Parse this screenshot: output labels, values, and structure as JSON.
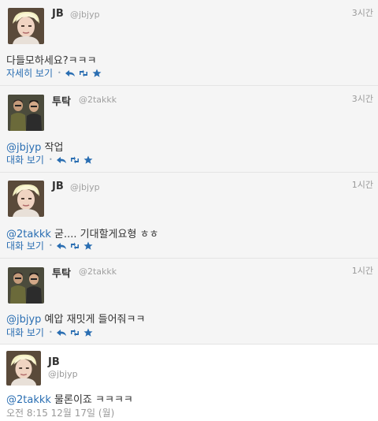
{
  "tweets": [
    {
      "name": "JB",
      "handle": "@jbjyp",
      "time": "3시간",
      "mention": "",
      "text": "다들모하세요?ㅋㅋㅋ",
      "action_label": "자세히 보기",
      "avatar": "blonde-person-avatar"
    },
    {
      "name": "투탁",
      "handle": "@2takkk",
      "time": "3시간",
      "mention": "@jbjyp",
      "text": " 작업",
      "action_label": "대화 보기",
      "avatar": "two-men-avatar"
    },
    {
      "name": "JB",
      "handle": "@jbjyp",
      "time": "1시간",
      "mention": "@2takkk",
      "text": " 굳.... 기대할게요형 ㅎㅎ",
      "action_label": "대화 보기",
      "avatar": "blonde-person-avatar"
    },
    {
      "name": "투탁",
      "handle": "@2takkk",
      "time": "1시간",
      "mention": "@jbjyp",
      "text": " 예압 재밋게 들어줘ㅋㅋ",
      "action_label": "대화 보기",
      "avatar": "two-men-avatar"
    }
  ],
  "expanded": {
    "name": "JB",
    "handle": "@jbjyp",
    "mention": "@2takkk",
    "text": " 물론이죠 ㅋㅋㅋㅋ",
    "timestamp": "오전 8:15 12월 17일 (월)",
    "avatar": "blonde-person-avatar"
  },
  "icons": {
    "reply": "reply-icon",
    "retweet": "retweet-icon",
    "favorite": "star-icon"
  },
  "colors": {
    "link": "#2a6eb2",
    "muted": "#999999",
    "background": "#f5f5f5"
  }
}
